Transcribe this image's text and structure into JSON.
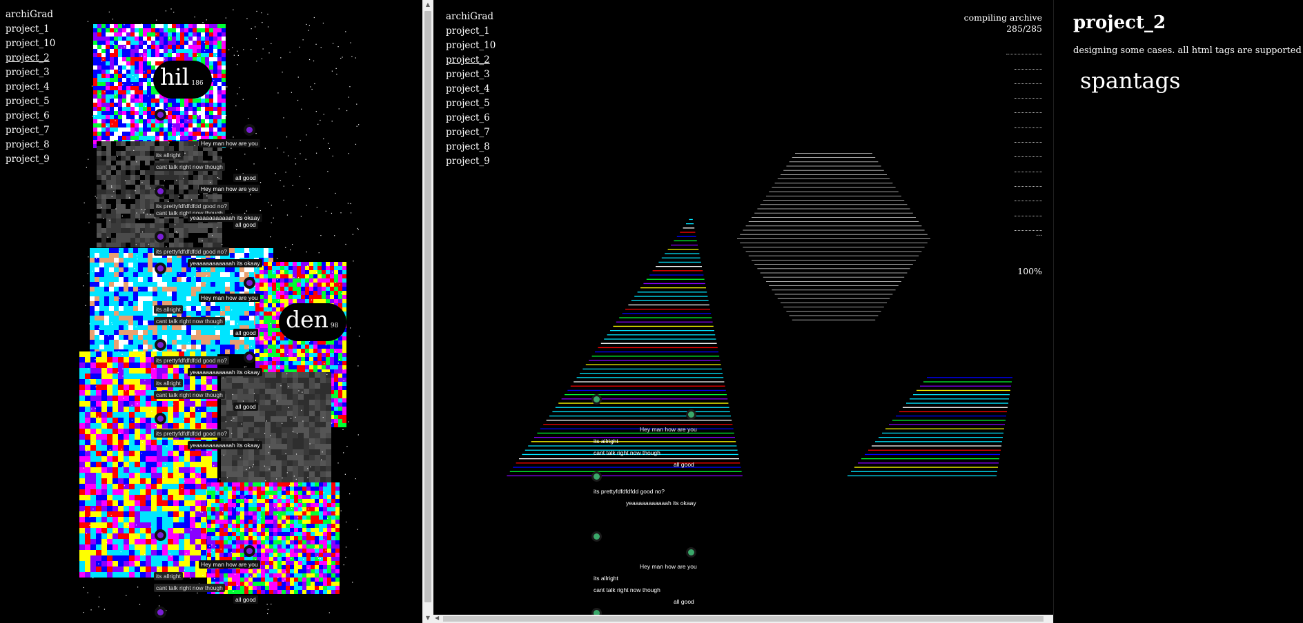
{
  "nav": {
    "brand": "archiGrad",
    "items": [
      "project_1",
      "project_10",
      "project_2",
      "project_3",
      "project_4",
      "project_5",
      "project_6",
      "project_7",
      "project_8",
      "project_9"
    ],
    "active": "project_2"
  },
  "left_labels": {
    "hil": {
      "name": "hil",
      "count": "186"
    },
    "den": {
      "name": "den",
      "count": "98"
    }
  },
  "chat": {
    "hey": "Hey man how are you",
    "allright": "its allright",
    "cant_talk": "cant talk right now though",
    "all_good": "all good",
    "pretty": "its prettyfdfdfdfdd good no?",
    "okay": "yeaaaaaaaaaaah its okaay"
  },
  "status": {
    "compiling": "compiling archive",
    "counter": "285/285",
    "percent": "100%",
    "trailing": "..."
  },
  "detail": {
    "title": "project_2",
    "description": "designing some cases. all html tags are supported",
    "tag": "spantags"
  },
  "colors": {
    "background": "#000000",
    "voxel_palette": [
      "#00e5ff",
      "#ffff00",
      "#ff0000",
      "#0000ff",
      "#00ff33",
      "#ff00ff",
      "#8800ff",
      "#ffffff",
      "#555555"
    ],
    "avatar_left": "#7a1fd6",
    "avatar_center": "#3aa86a"
  }
}
